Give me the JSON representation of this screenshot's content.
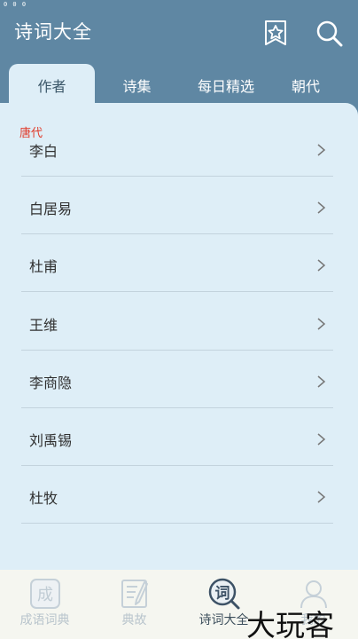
{
  "status_bar": {
    "text": "0 0 0"
  },
  "header": {
    "title": "诗词大全",
    "favorite_icon": "star-bookmark-icon",
    "search_icon": "search-icon"
  },
  "tabs": [
    {
      "label": "作者",
      "active": true
    },
    {
      "label": "诗集",
      "active": false
    },
    {
      "label": "每日精选",
      "active": false
    },
    {
      "label": "朝代",
      "active": false
    }
  ],
  "section": {
    "dynasty": "唐代"
  },
  "authors": [
    "李白",
    "白居易",
    "杜甫",
    "王维",
    "李商隐",
    "刘禹锡",
    "杜牧"
  ],
  "bottom_nav": [
    {
      "label": "成语词典",
      "icon": "idiom-dictionary-icon",
      "glyph": "成",
      "active": false
    },
    {
      "label": "典故",
      "icon": "allusion-book-icon",
      "active": false
    },
    {
      "label": "诗词大全",
      "icon": "poetry-search-icon",
      "glyph": "词",
      "active": true
    },
    {
      "label": "我的",
      "icon": "person-icon",
      "active": false
    }
  ],
  "watermark": "大玩客",
  "colors": {
    "header_bg": "#5f87a3",
    "content_bg": "#deeef7",
    "accent_red": "#e03a2a",
    "nav_bg": "#f5f6f0"
  }
}
